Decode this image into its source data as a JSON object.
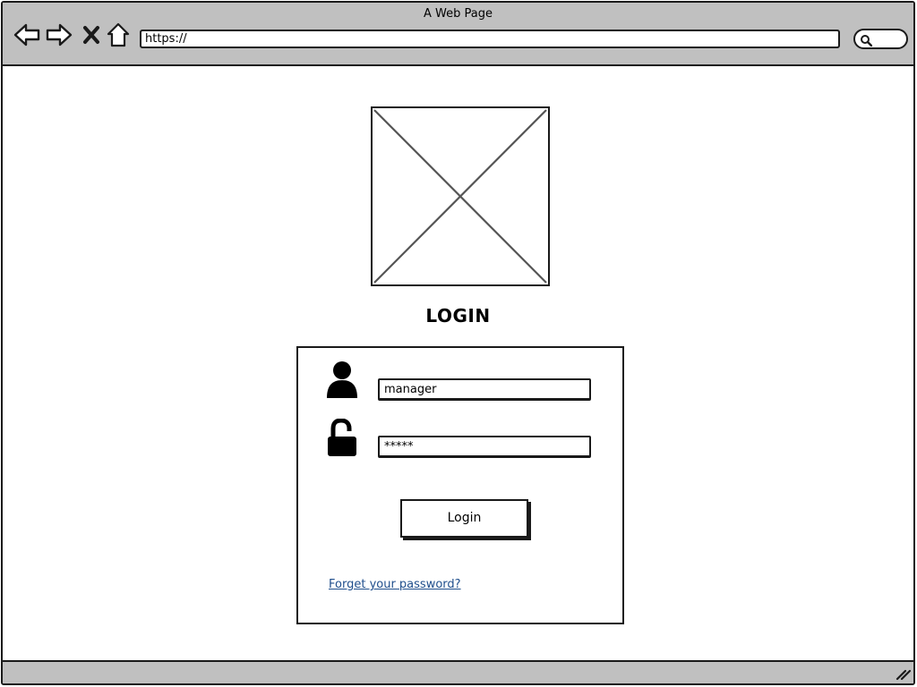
{
  "browser": {
    "window_title": "A Web Page",
    "url": "https://",
    "nav": {
      "back_icon": "arrow-left-icon",
      "forward_icon": "arrow-right-icon",
      "stop_icon": "close-icon",
      "home_icon": "home-icon",
      "search_icon": "search-icon"
    },
    "chrome_color": "#c0c0c0"
  },
  "page": {
    "logo_placeholder_icon": "image-placeholder-icon",
    "title": "LOGIN",
    "form": {
      "user_icon": "user-icon",
      "lock_icon": "unlock-icon",
      "username_value": "manager",
      "password_value": "*****",
      "login_button_label": "Login",
      "forgot_password_label": "Forget your password?",
      "link_color": "#1f4e8c"
    }
  }
}
